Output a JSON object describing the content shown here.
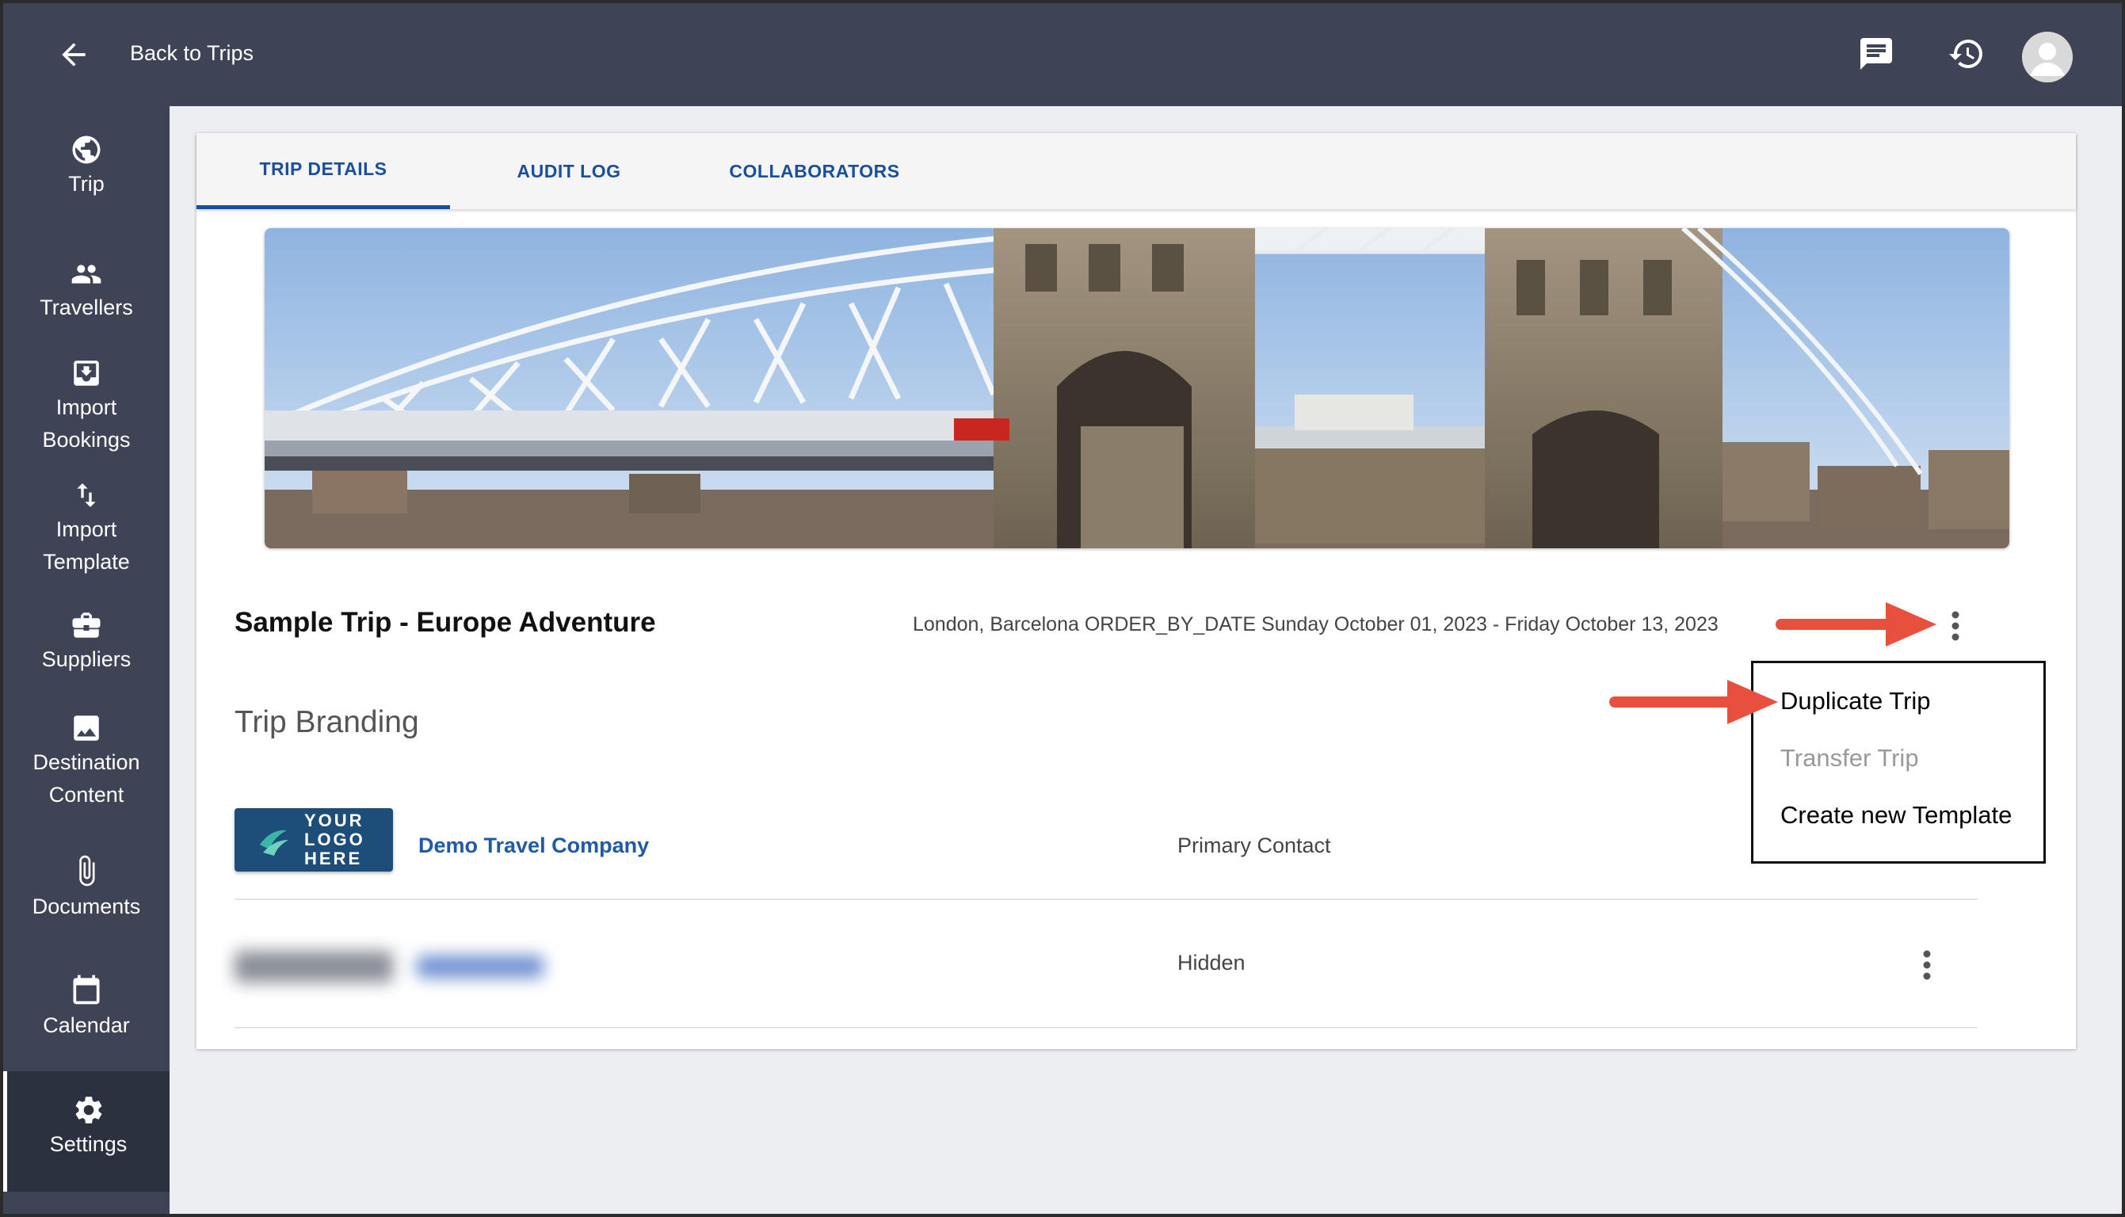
{
  "header": {
    "back_label": "Back to Trips",
    "icons": [
      "arrow-back-icon",
      "chat-icon",
      "history-icon",
      "avatar"
    ]
  },
  "sidebar": {
    "items": [
      {
        "label": "Trip",
        "icon": "globe-icon"
      },
      {
        "label": "Travellers",
        "icon": "people-icon"
      },
      {
        "label": "Import Bookings",
        "icon": "import-icon"
      },
      {
        "label": "Import Template",
        "icon": "swap-vert-icon"
      },
      {
        "label": "Suppliers",
        "icon": "briefcase-icon"
      },
      {
        "label": "Destination Content",
        "icon": "image-icon"
      },
      {
        "label": "Documents",
        "icon": "paperclip-icon"
      },
      {
        "label": "Calendar",
        "icon": "calendar-icon"
      },
      {
        "label": "Settings",
        "icon": "gear-icon",
        "active": true
      }
    ]
  },
  "tabs": [
    {
      "label": "TRIP DETAILS",
      "active": true
    },
    {
      "label": "AUDIT LOG"
    },
    {
      "label": "COLLABORATORS"
    }
  ],
  "trip": {
    "title": "Sample Trip - Europe Adventure",
    "meta": "London, Barcelona ORDER_BY_DATE Sunday October 01, 2023 - Friday October 13, 2023"
  },
  "branding": {
    "section_title": "Trip Branding",
    "logo_text": "YOUR LOGO HERE",
    "company": "Demo Travel Company",
    "primary_contact": "Primary Contact",
    "hidden_label": "Hidden"
  },
  "menu": {
    "items": [
      {
        "label": "Duplicate Trip",
        "enabled": true
      },
      {
        "label": "Transfer Trip",
        "enabled": false
      },
      {
        "label": "Create new Template",
        "enabled": true
      }
    ]
  },
  "colors": {
    "topbar": "#3e4455",
    "accent": "#1a4fa0",
    "annotation_arrow": "#e8503e"
  }
}
